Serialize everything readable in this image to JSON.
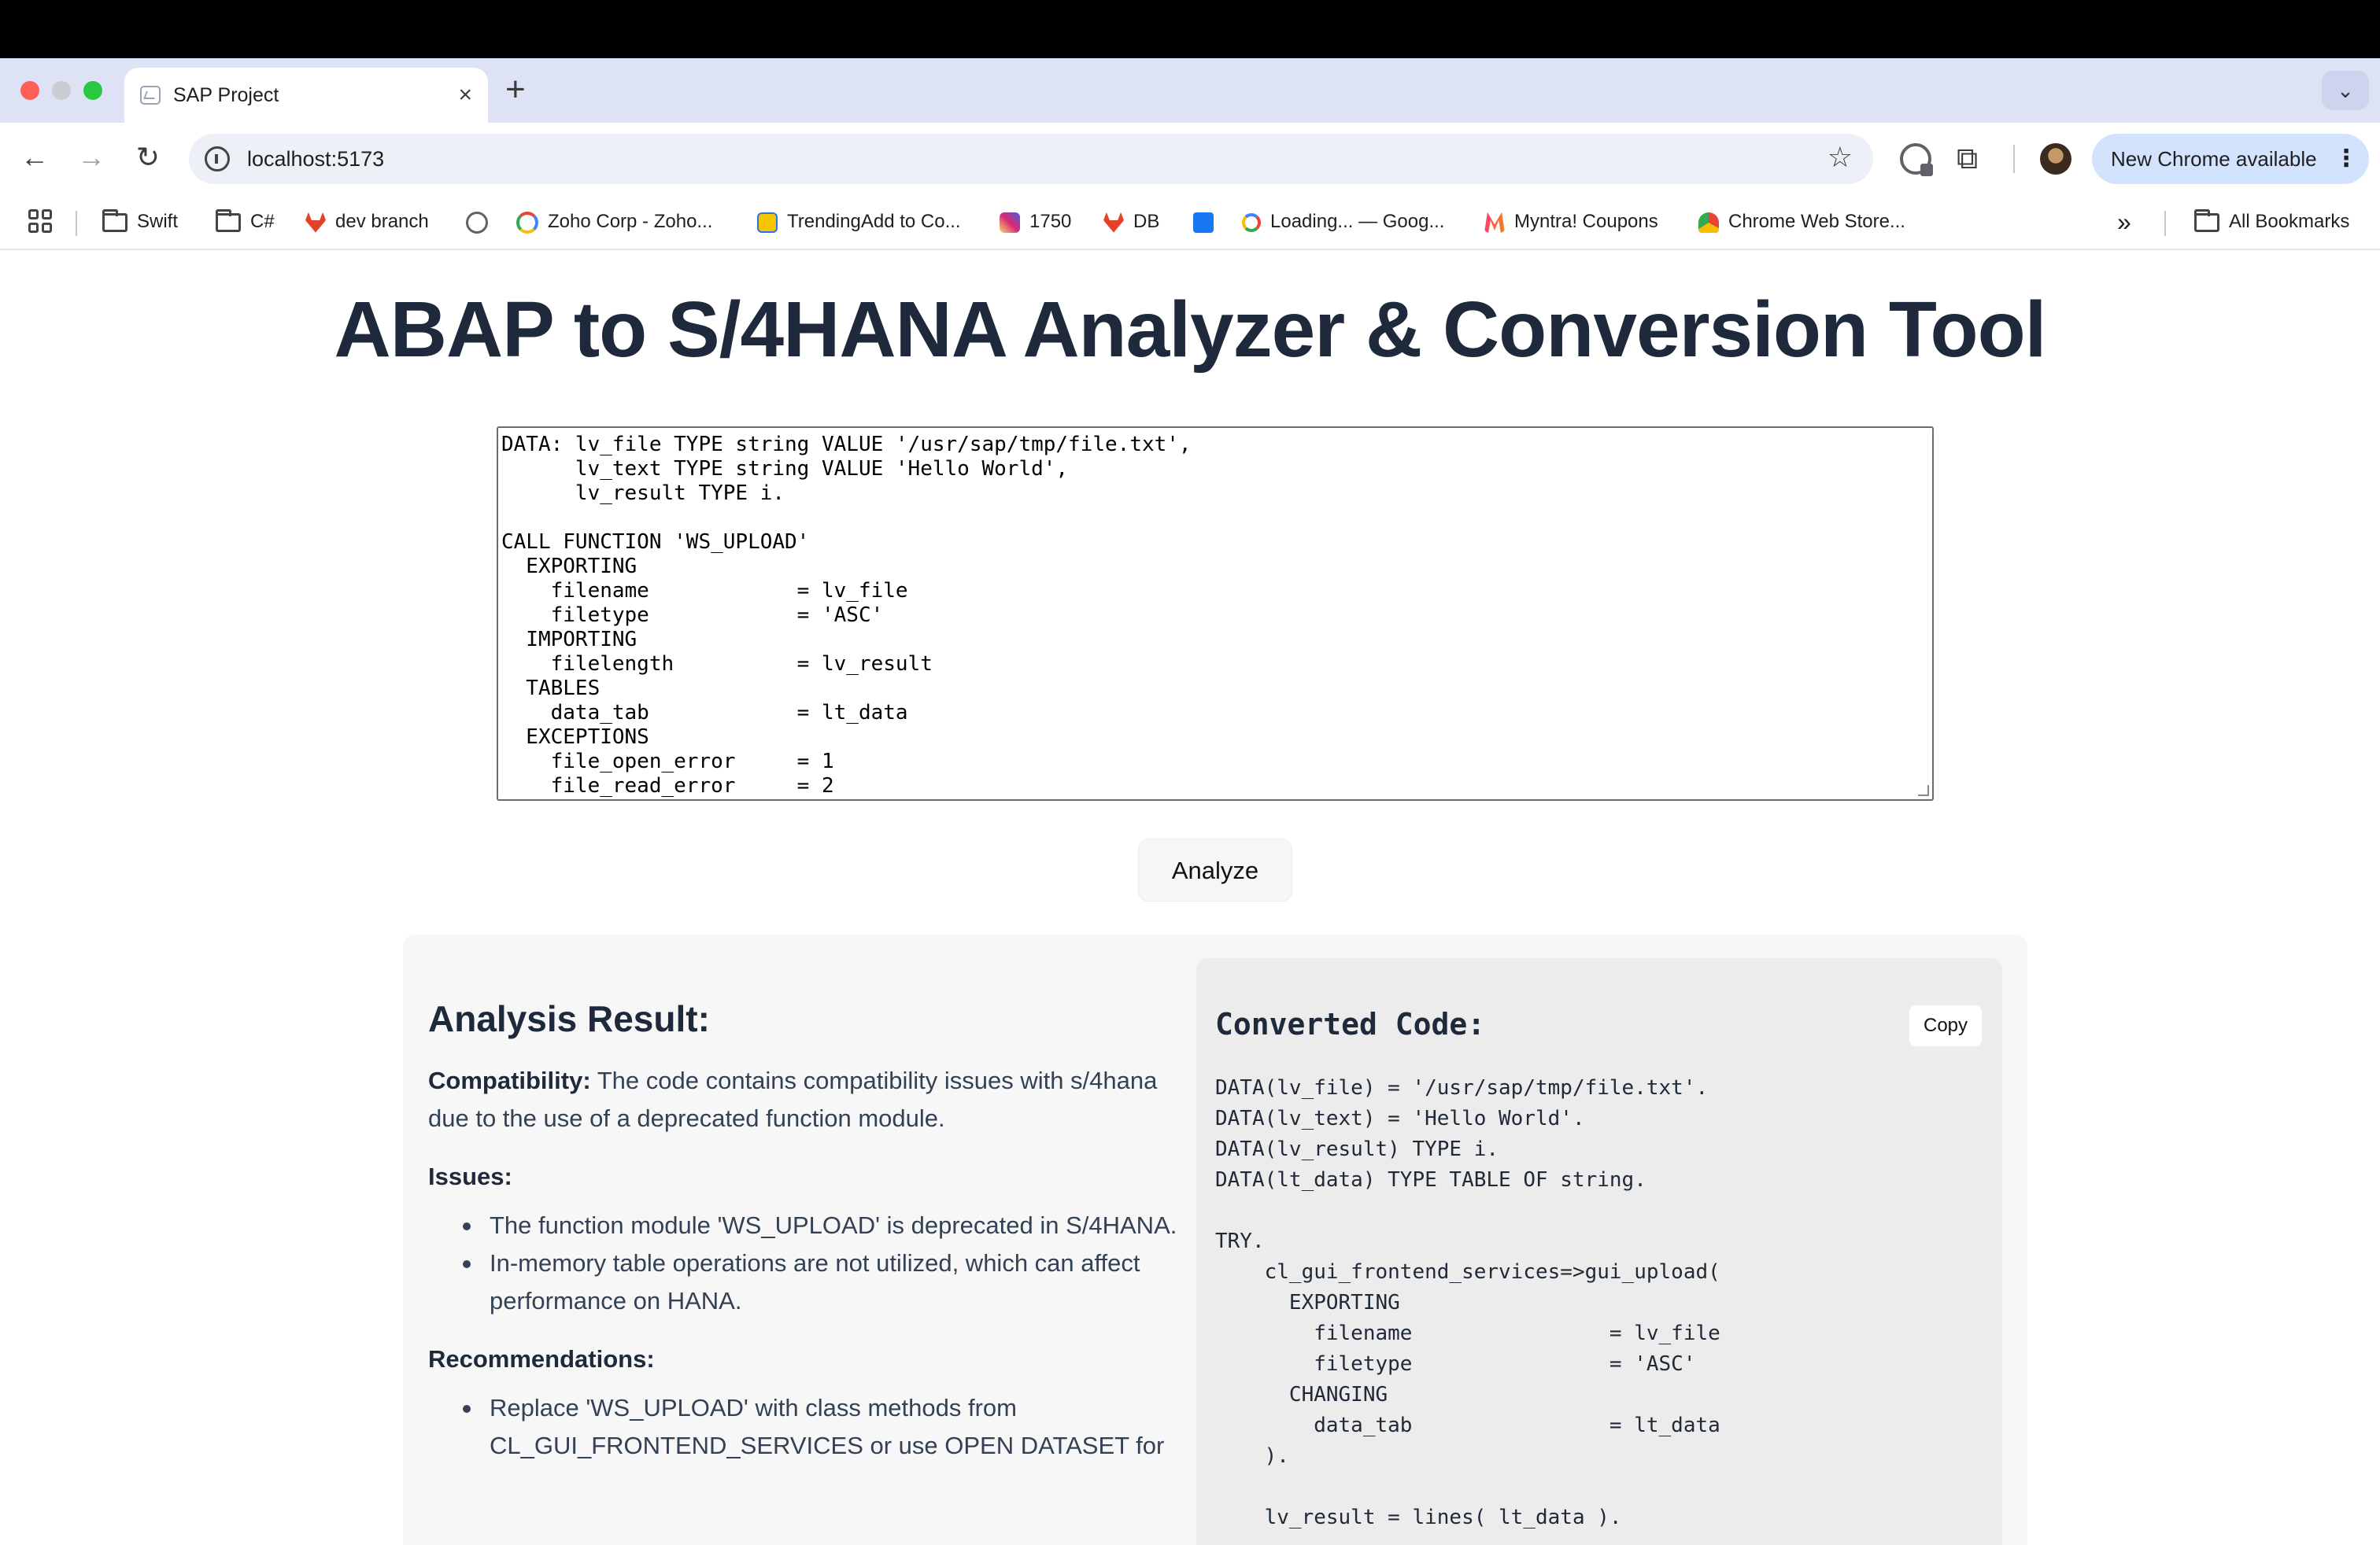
{
  "browser": {
    "tab_title": "SAP Project",
    "tab_close": "×",
    "new_tab": "+",
    "tab_dropdown": "⌄",
    "url": "localhost:5173",
    "update_label": "New Chrome available",
    "update_menu": "⋮",
    "nav": {
      "back": "←",
      "forward": "→",
      "reload": "↻",
      "star": "☆",
      "extensions": "⧉"
    },
    "bookmarks": [
      {
        "label": "Swift",
        "icon": "folder-icon"
      },
      {
        "label": "C#",
        "icon": "folder-icon"
      },
      {
        "label": "dev branch",
        "icon": "gitlab-icon",
        "color": "#e24329"
      },
      {
        "label": "",
        "icon": "globe-icon",
        "color": "#5f6368"
      },
      {
        "label": "Zoho Corp - Zoho...",
        "icon": "zoho-icon",
        "color": "#34a853"
      },
      {
        "label": "TrendingAdd to Co...",
        "icon": "flipkart-icon",
        "color": "#f7c600"
      },
      {
        "label": "1750",
        "icon": "instagram-icon",
        "color": "#d62976"
      },
      {
        "label": "DB",
        "icon": "gitlab-icon",
        "color": "#e24329"
      },
      {
        "label": "",
        "icon": "facebook-icon",
        "color": "#1877f2"
      },
      {
        "label": "Loading... — Goog...",
        "icon": "google-icon",
        "color": "#4285f4"
      },
      {
        "label": "Myntra! Coupons",
        "icon": "myntra-icon",
        "color": "#ff3f6c"
      },
      {
        "label": "Chrome Web Store...",
        "icon": "webstore-icon",
        "color": "#fbbc04"
      }
    ],
    "more_bookmarks": "»",
    "all_bookmarks": "All Bookmarks"
  },
  "page": {
    "title": "ABAP to S/4HANA Analyzer & Conversion Tool",
    "input_code": "DATA: lv_file TYPE string VALUE '/usr/sap/tmp/file.txt',\n      lv_text TYPE string VALUE 'Hello World',\n      lv_result TYPE i.\n\nCALL FUNCTION 'WS_UPLOAD'\n  EXPORTING\n    filename            = lv_file\n    filetype            = 'ASC'\n  IMPORTING\n    filelength          = lv_result\n  TABLES\n    data_tab            = lt_data\n  EXCEPTIONS\n    file_open_error     = 1\n    file_read_error     = 2",
    "analyze_button": "Analyze"
  },
  "analysis": {
    "heading": "Analysis Result:",
    "compatibility_label": "Compatibility:",
    "compatibility_text": " The code contains compatibility issues with s/4hana due to the use of a deprecated function module.",
    "issues_label": "Issues:",
    "issues": [
      "The function module 'WS_UPLOAD' is deprecated in S/4HANA.",
      "In-memory table operations are not utilized, which can affect performance on HANA."
    ],
    "recommendations_label": "Recommendations:",
    "recommendations": [
      "Replace 'WS_UPLOAD' with class methods from CL_GUI_FRONTEND_SERVICES or use OPEN DATASET for"
    ]
  },
  "converted": {
    "heading": "Converted Code:",
    "copy_button": "Copy",
    "code": "DATA(lv_file) = '/usr/sap/tmp/file.txt'.\nDATA(lv_text) = 'Hello World'.\nDATA(lv_result) TYPE i.\nDATA(lt_data) TYPE TABLE OF string.\n\nTRY.\n    cl_gui_frontend_services=>gui_upload(\n      EXPORTING\n        filename                = lv_file\n        filetype                = 'ASC'\n      CHANGING\n        data_tab                = lt_data\n    ).\n\n    lv_result = lines( lt_data )."
  }
}
